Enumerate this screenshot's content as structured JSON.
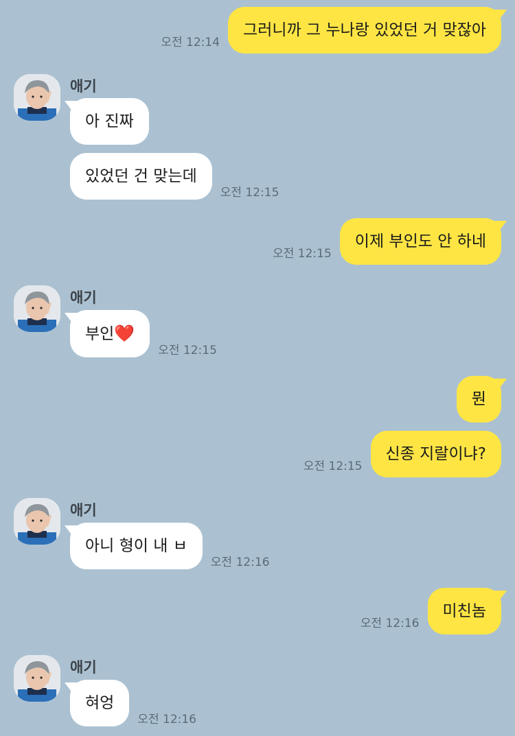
{
  "friend": {
    "name": "애기"
  },
  "messages": [
    {
      "from": "me",
      "text": "그러니까 그 누나랑 있었던 거 맞잖아",
      "time": "오전 12:14"
    },
    {
      "from": "friend",
      "text": "아 진짜",
      "time": ""
    },
    {
      "from": "friend",
      "text": "있었던 건 맞는데",
      "time": "오전 12:15"
    },
    {
      "from": "me",
      "text": "이제 부인도 안 하네",
      "time": "오전 12:15"
    },
    {
      "from": "friend",
      "text": "부인",
      "emoji": "❤️",
      "time": "오전 12:15"
    },
    {
      "from": "me",
      "text": "뭔",
      "time": ""
    },
    {
      "from": "me",
      "text": "신종 지랄이냐?",
      "time": "오전 12:15"
    },
    {
      "from": "friend",
      "text": "아니 형이 내 ㅂ",
      "time": "오전 12:16"
    },
    {
      "from": "me",
      "text": "미친놈",
      "time": "오전 12:16"
    },
    {
      "from": "friend",
      "text": "혀엉",
      "time": "오전 12:16"
    }
  ],
  "colors": {
    "background": "#abc1d1",
    "outgoing_bubble": "#fee544",
    "incoming_bubble": "#ffffff",
    "timestamp": "#5a6a78"
  }
}
